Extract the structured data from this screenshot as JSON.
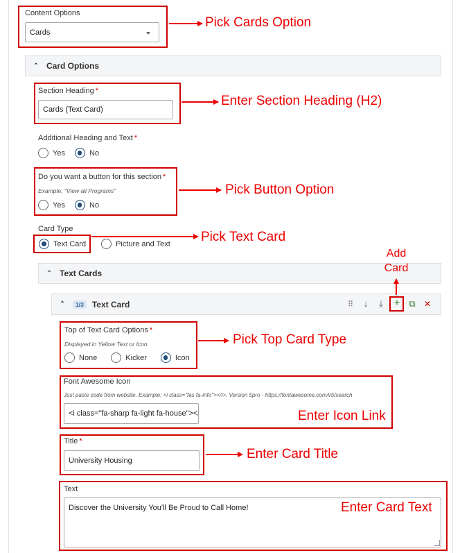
{
  "content_options": {
    "label": "Content Options",
    "selected": "Cards"
  },
  "card_options": {
    "title": "Card Options",
    "section_heading": {
      "label": "Section Heading",
      "required_mark": "*",
      "value": "Cards (Text Card)"
    },
    "additional_heading": {
      "label": "Additional Heading and Text",
      "required_mark": "*",
      "options": [
        "Yes",
        "No"
      ],
      "selected": "No"
    },
    "button_option": {
      "label": "Do you want a button for this section",
      "required_mark": "*",
      "hint": "Example, \"View all Programs\"",
      "options": [
        "Yes",
        "No"
      ],
      "selected": "No"
    },
    "card_type": {
      "label": "Card Type",
      "options": [
        "Text Card",
        "Picture and Text"
      ],
      "selected": "Text Card"
    }
  },
  "text_cards": {
    "title": "Text Cards",
    "card": {
      "counter": "1/3",
      "title": "Text Card",
      "toolbar": {
        "drag_glyph": "⠿",
        "move_down_glyph": "↓",
        "move_bottom_glyph": "⤓",
        "add_glyph": "+",
        "copy_glyph": "⧉",
        "remove_glyph": "✕"
      },
      "top_options": {
        "label": "Top of Text Card Options",
        "required_mark": "*",
        "hint": "Displayed in Yellow Text or Icon",
        "options": [
          "None",
          "Kicker",
          "Icon"
        ],
        "selected": "Icon"
      },
      "font_awesome": {
        "label": "Font Awesome Icon",
        "hint": "Just paste code from website. Example: <i class=\"fas fa-info\"></i>. Version 5pro - https://fontawesome.com/v5/search",
        "value": "<i class=\"fa-sharp fa-light fa-house\"></i>"
      },
      "title_field": {
        "label": "Title",
        "required_mark": "*",
        "value": "University Housing"
      },
      "text_field": {
        "label": "Text",
        "value": "Discover the University You'll Be Proud to Call Home!"
      }
    }
  },
  "annotations": {
    "pick_cards": "Pick Cards Option",
    "enter_heading": "Enter Section Heading (H2)",
    "pick_button": "Pick Button Option",
    "pick_text_card": "Pick Text Card",
    "add_card": "Add\nCard",
    "pick_top_card": "Pick Top Card Type",
    "enter_icon": "Enter Icon Link",
    "enter_title": "Enter Card Title",
    "enter_text": "Enter Card Text"
  },
  "colors": {
    "annotation_red": "#ee0000",
    "radio_selected": "#1f4e79",
    "required_red": "#cc0000",
    "panel_header_bg": "#f4f5f7",
    "badge_bg": "#dbe6f3"
  }
}
